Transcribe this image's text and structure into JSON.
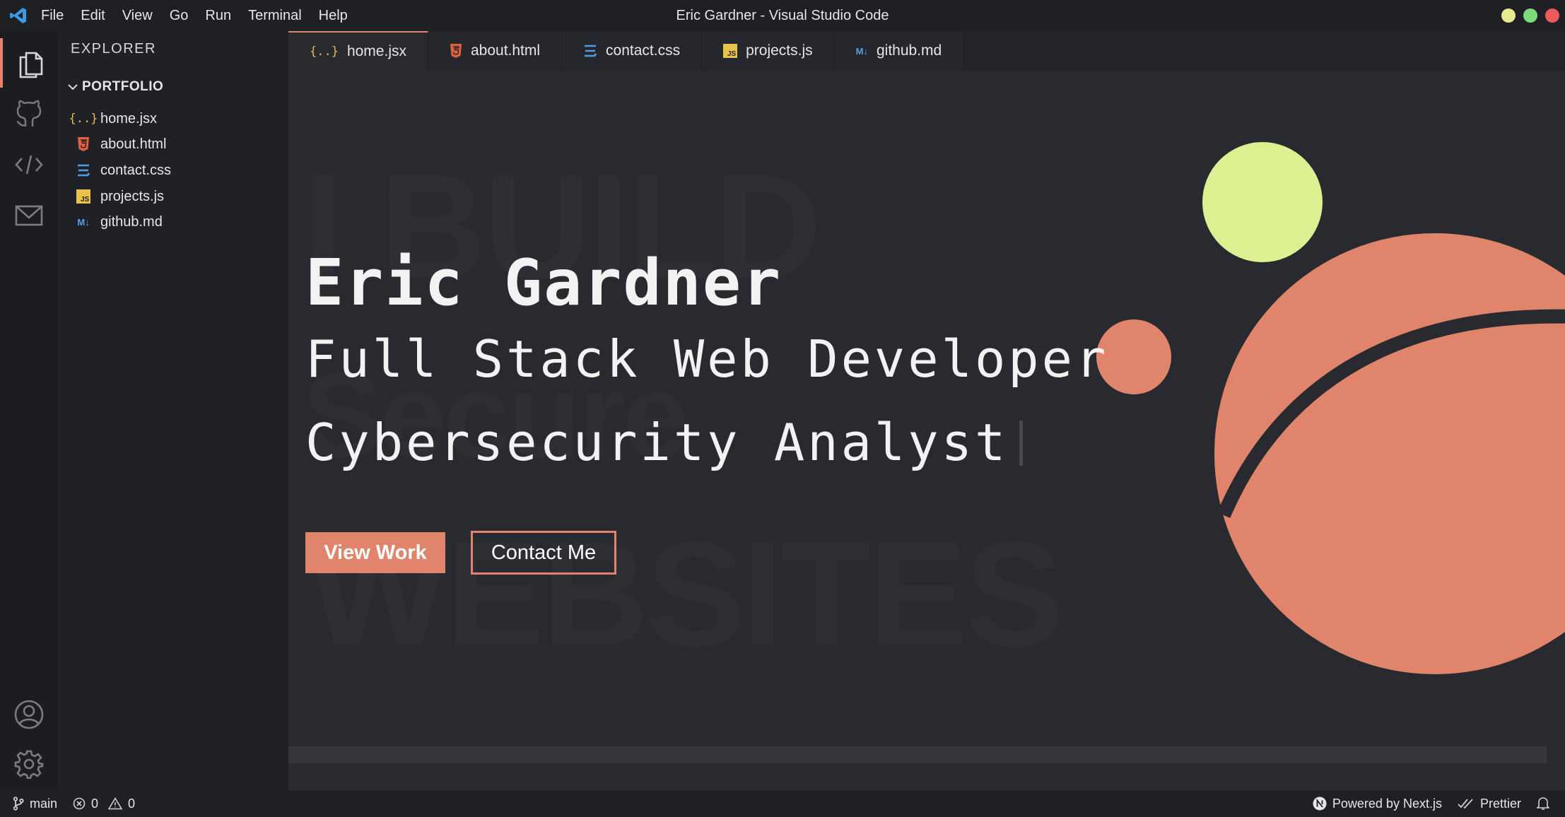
{
  "window": {
    "title": "Eric Gardner - Visual Studio Code",
    "controls": {
      "yellow": "#e6ec8e",
      "green": "#7cdc7c",
      "red": "#ec5a5a"
    }
  },
  "menu": [
    "File",
    "Edit",
    "View",
    "Go",
    "Run",
    "Terminal",
    "Help"
  ],
  "activity_bar": {
    "icons": [
      "files-icon",
      "github-icon",
      "code-icon",
      "mail-icon",
      "account-icon",
      "gear-icon"
    ],
    "active": "files-icon"
  },
  "sidebar": {
    "title": "EXPLORER",
    "folder": "PORTFOLIO",
    "files": [
      {
        "label": "home.jsx",
        "icon": "jsx-braces-icon"
      },
      {
        "label": "about.html",
        "icon": "html5-icon"
      },
      {
        "label": "contact.css",
        "icon": "css3-icon"
      },
      {
        "label": "projects.js",
        "icon": "js-icon"
      },
      {
        "label": "github.md",
        "icon": "markdown-icon"
      }
    ]
  },
  "tabs": [
    {
      "label": "home.jsx",
      "active": true
    },
    {
      "label": "about.html",
      "active": false
    },
    {
      "label": "contact.css",
      "active": false
    },
    {
      "label": "projects.js",
      "active": false
    },
    {
      "label": "github.md",
      "active": false
    }
  ],
  "hero": {
    "background_words": [
      "I BUILD",
      "Secure",
      "WEBSITES"
    ],
    "name": "Eric Gardner",
    "role_1": "Full Stack Web Developer",
    "role_2": "Cybersecurity Analyst",
    "primary_button": "View Work",
    "secondary_button": "Contact Me"
  },
  "colors": {
    "accent": "#e0856b",
    "lime": "#dcef91",
    "background": "#282a2f",
    "sidebar": "#202126"
  },
  "statusbar": {
    "branch": "main",
    "errors": "0",
    "warnings": "0",
    "powered_by": "Powered by Next.js",
    "formatter": "Prettier"
  }
}
